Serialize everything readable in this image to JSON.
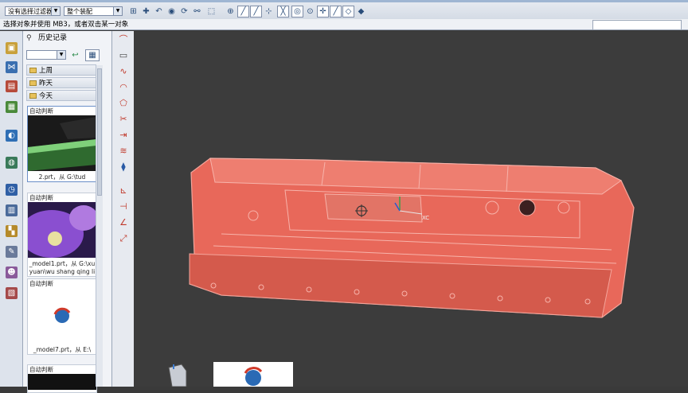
{
  "toolbar": {
    "filter_combo": "没有选择过滤器",
    "assembly_combo": "整个装配"
  },
  "statusbar": {
    "prompt": "选择对象并使用 MB3，或者双击某一对象"
  },
  "resource_bar": {
    "icons": [
      "assembly-navigator-icon",
      "constraint-navigator-icon",
      "part-navigator-icon",
      "reuse-library-icon",
      "hd3d-tools-icon",
      "web-browser-icon",
      "history-icon",
      "process-studio-icon",
      "palette-icon",
      "system-materials-icon",
      "roles-icon",
      "system-scenes-icon"
    ]
  },
  "history": {
    "title": "历史记录",
    "groups": [
      "上周",
      "昨天",
      "今天"
    ],
    "cards": [
      {
        "caption": "自动判断",
        "name": "2.prt，从 G:\\tud"
      },
      {
        "caption": "自动判断",
        "name": "_model1.prt，从 G:\\xu",
        "name2": "yuan\\wu shang qing li"
      },
      {
        "caption": "自动判断",
        "name": "_model7.prt，从 E:\\"
      },
      {
        "caption": "自动判断",
        "name": ""
      }
    ]
  },
  "viewport": {
    "part_color": "#e8685a",
    "axis_label_x": "XC"
  },
  "colors": {
    "toolbar_bg": "#dde3ec",
    "viewport_bg": "#3c3c3c"
  }
}
